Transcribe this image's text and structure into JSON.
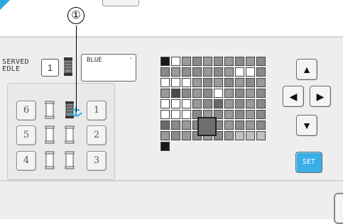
{
  "callout": {
    "number": "①"
  },
  "served": {
    "line1": "SERVED",
    "line2": "EDLE",
    "needle_number": "1",
    "color_name": "BLUE",
    "color_tick": "'"
  },
  "needle_buttons": [
    {
      "id": "6",
      "label": "6"
    },
    {
      "id": "1",
      "label": "1"
    },
    {
      "id": "5",
      "label": "5"
    },
    {
      "id": "2",
      "label": "2"
    },
    {
      "id": "4",
      "label": "4"
    },
    {
      "id": "3",
      "label": "3"
    }
  ],
  "grid": {
    "rows": [
      [
        "#1a1a1a",
        "#ffffff",
        "#9a9a9a",
        "#8a8a8a",
        "#9a9a9a",
        "#8f8f8f",
        "#9a9a9a",
        "#8a8a8a",
        "#9a9a9a",
        "#8a8a8a"
      ],
      [
        "#8a8a8a",
        "#9a9a9a",
        "#8f8f8f",
        "#8a8a8a",
        "#9a9a9a",
        "#8a8a8a",
        "#9a9a9a",
        "#ffffff",
        "#ffffff",
        "#8a8a8a"
      ],
      [
        "#ffffff",
        "#ffffff",
        "#ffffff",
        "#9a9a9a",
        "#8a8a8a",
        "#9a9a9a",
        "#8a8a8a",
        "#9a9a9a",
        "#8a8a8a",
        "#9a9a9a"
      ],
      [
        "#9a9a9a",
        "#4a4a4a",
        "#8a8a8a",
        "#9a9a9a",
        "#8a8a8a",
        "#ffffff",
        "#9a9a9a",
        "#8a8a8a",
        "#9a9a9a",
        "#8a8a8a"
      ],
      [
        "#ffffff",
        "#ffffff",
        "#ffffff",
        "#9a9a9a",
        "#8a8a8a",
        "#6a6a6a",
        "#9a9a9a",
        "#8a8a8a",
        "#9a9a9a",
        "#8a8a8a"
      ],
      [
        "#ffffff",
        "#ffffff",
        "#ffffff",
        "#8a8a8a",
        "#9a9a9a",
        "#8a8a8a",
        "#9a9a9a",
        "#8a8a8a",
        "#9a9a9a",
        "#8a8a8a"
      ],
      [
        "#6a6a6a",
        "#8a8a8a",
        "#9a9a9a",
        "#8a8a8a",
        "#9a9a9a",
        "#8a8a8a",
        "#9a9a9a",
        "#8a8a8a",
        "#9a9a9a",
        "#8a8a8a"
      ],
      [
        "#9a9a9a",
        "#8a8a8a",
        "#9a9a9a",
        "#8a8a8a",
        "#9a9a9a",
        "#8a8a8a",
        "#9a9a9a",
        "#c0c0c0",
        "#c0c0c0",
        "#c0c0c0"
      ],
      [
        "#1a1a1a"
      ]
    ]
  },
  "arrows": {
    "up": "▲",
    "left": "◀",
    "right": "▶",
    "down": "▼"
  },
  "set_button": {
    "label": "SET",
    "color": "#39aee8"
  }
}
